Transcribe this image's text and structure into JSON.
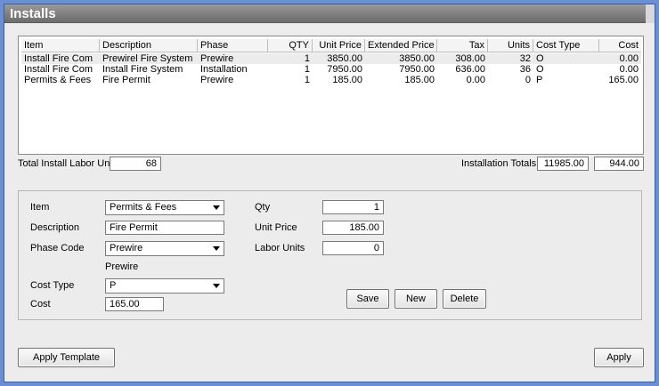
{
  "window": {
    "title": "Installs"
  },
  "grid": {
    "columns": [
      "Item",
      "Description",
      "Phase",
      "QTY",
      "Unit Price",
      "Extended Price",
      "Tax",
      "Units",
      "Cost Type",
      "Cost"
    ],
    "rows": [
      {
        "item": "Install Fire Com",
        "description": "Prewirel Fire System",
        "phase": "Prewire",
        "qty": "1",
        "unit_price": "3850.00",
        "extended_price": "3850.00",
        "tax": "308.00",
        "units": "32",
        "cost_type": "O",
        "cost": "0.00"
      },
      {
        "item": "Install Fire Com",
        "description": "Install Fire System",
        "phase": "Installation",
        "qty": "1",
        "unit_price": "7950.00",
        "extended_price": "7950.00",
        "tax": "636.00",
        "units": "36",
        "cost_type": "O",
        "cost": "0.00"
      },
      {
        "item": "Permits & Fees",
        "description": "Fire Permit",
        "phase": "Prewire",
        "qty": "1",
        "unit_price": "185.00",
        "extended_price": "185.00",
        "tax": "0.00",
        "units": "0",
        "cost_type": "P",
        "cost": "165.00"
      }
    ]
  },
  "totals": {
    "labor_units_label": "Total Install Labor Units",
    "labor_units_value": "68",
    "installation_totals_label": "Installation Totals",
    "installation_total_price": "11985.00",
    "installation_total_cost": "944.00"
  },
  "form": {
    "item_label": "Item",
    "item_value": "Permits & Fees",
    "description_label": "Description",
    "description_value": "Fire Permit",
    "phase_code_label": "Phase Code",
    "phase_code_value": "Prewire",
    "phase_code_caption": "Prewire",
    "cost_type_label": "Cost Type",
    "cost_type_value": "P",
    "cost_label": "Cost",
    "cost_value": "165.00",
    "qty_label": "Qty",
    "qty_value": "1",
    "unit_price_label": "Unit Price",
    "unit_price_value": "185.00",
    "labor_units_label": "Labor Units",
    "labor_units_value": "0",
    "save_label": "Save",
    "new_label": "New",
    "delete_label": "Delete"
  },
  "footer": {
    "apply_template_label": "Apply Template",
    "apply_label": "Apply"
  }
}
